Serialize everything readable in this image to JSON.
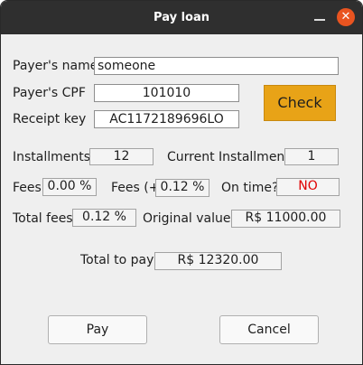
{
  "window": {
    "title": "Pay loan"
  },
  "form": {
    "payer_name_label": "Payer's name",
    "payer_name_value": "someone",
    "payer_cpf_label": "Payer's CPF",
    "payer_cpf_value": "101010",
    "receipt_key_label": "Receipt key",
    "receipt_key_value": "AC1172189696LO",
    "check_button": "Check"
  },
  "details": {
    "installments_label": "Installments",
    "installments_value": "12",
    "current_installment_label": "Current Installment",
    "current_installment_value": "1",
    "fees_label": "Fees",
    "fees_value": "0.00 %",
    "fees_plus_label": "Fees (+)",
    "fees_plus_value": "0.12 %",
    "on_time_label": "On time?",
    "on_time_value": "NO",
    "total_fees_label": "Total fees",
    "total_fees_value": "0.12 %",
    "original_value_label": "Original value",
    "original_value_value": "R$ 11000.00",
    "total_to_pay_label": "Total to pay",
    "total_to_pay_value": "R$ 12320.00"
  },
  "actions": {
    "pay": "Pay",
    "cancel": "Cancel"
  },
  "colors": {
    "accent": "#e8a317",
    "warning_text": "#e00000",
    "titlebar": "#2f2f2f",
    "close": "#e95420"
  },
  "icons": {
    "minimize": "minimize-icon",
    "close": "close-icon"
  }
}
